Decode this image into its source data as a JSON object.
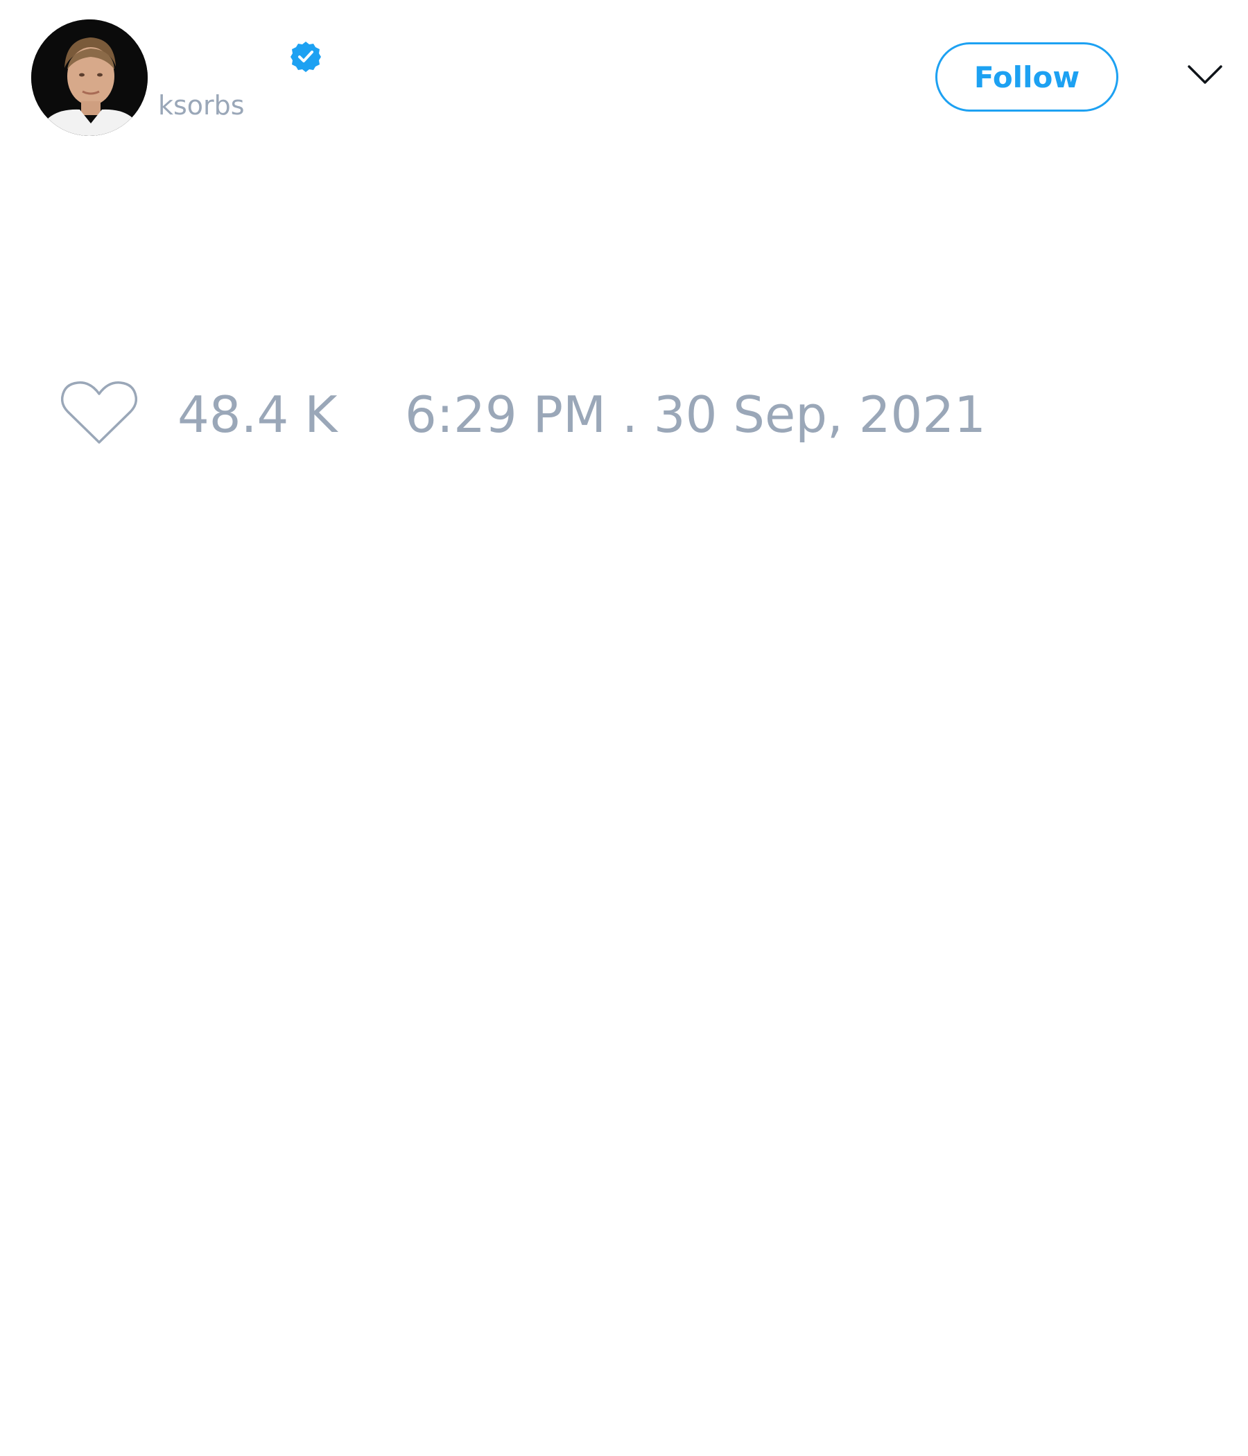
{
  "tweet": {
    "author": {
      "display_name": "",
      "handle": "ksorbs",
      "verified": true,
      "avatar_icon": "profile-photo"
    },
    "follow_label": "Follow",
    "menu_icon": "chevron-down-icon",
    "likes": {
      "icon": "heart-icon",
      "count": "48.4 K"
    },
    "timestamp": "6:29 PM . 30 Sep, 2021"
  },
  "colors": {
    "accent": "#1da1f2",
    "muted_text": "#9aa7b8",
    "background": "#ffffff"
  }
}
